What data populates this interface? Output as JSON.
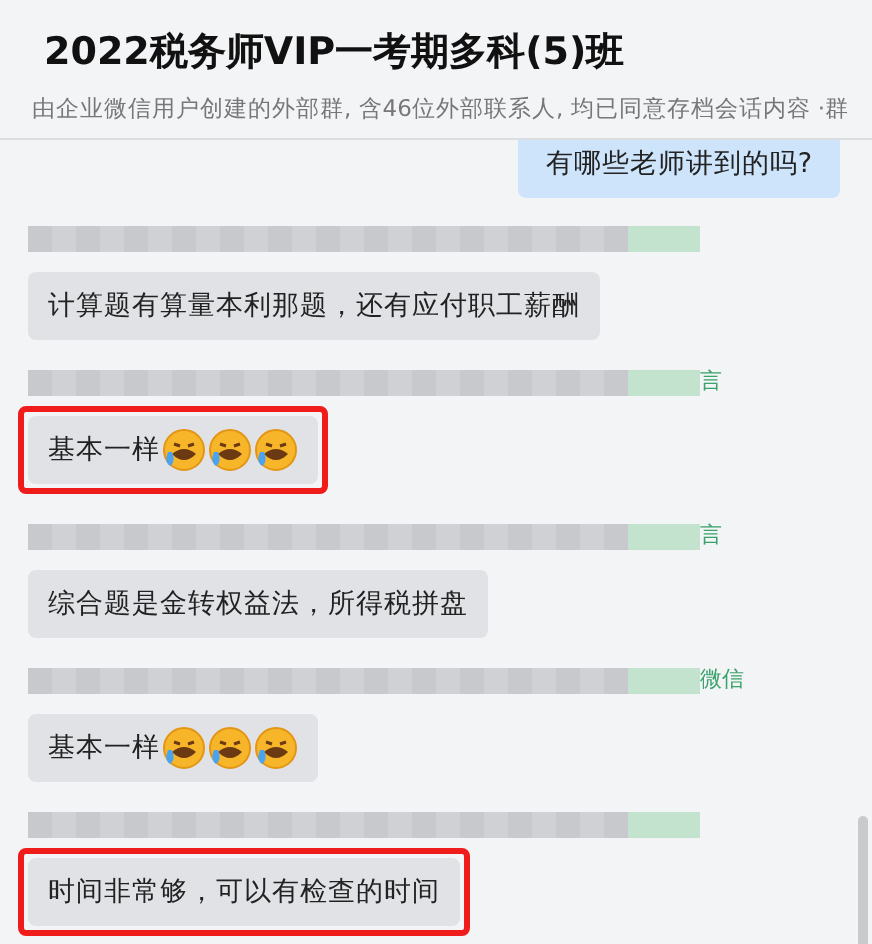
{
  "header": {
    "title": "2022税务师VIP一考期多科(5)班",
    "subtitle": "由企业微信用户创建的外部群, 含46位外部联系人, 均已同意存档会话内容 ·群"
  },
  "messages": [
    {
      "kind": "outgoing",
      "text": "有哪些老师讲到的吗?"
    },
    {
      "kind": "incoming",
      "text": "计算题有算量本利那题，还有应付职工薪酬",
      "highlighted": false
    },
    {
      "kind": "incoming",
      "text": "基本一样",
      "tag": "言",
      "emojis": [
        {
          "kind": "laugh-cry"
        },
        {
          "kind": "laugh-cry"
        },
        {
          "kind": "laugh-cry"
        }
      ],
      "highlighted": true
    },
    {
      "kind": "incoming",
      "text": "综合题是金转权益法，所得税拼盘",
      "tag": "言",
      "highlighted": false
    },
    {
      "kind": "incoming",
      "text": "基本一样",
      "tag": "微信",
      "emojis": [
        {
          "kind": "laugh-cry"
        },
        {
          "kind": "laugh-cry"
        },
        {
          "kind": "laugh-cry"
        }
      ],
      "highlighted": false
    },
    {
      "kind": "incoming",
      "text": "时间非常够，可以有检查的时间",
      "highlighted": true
    }
  ]
}
